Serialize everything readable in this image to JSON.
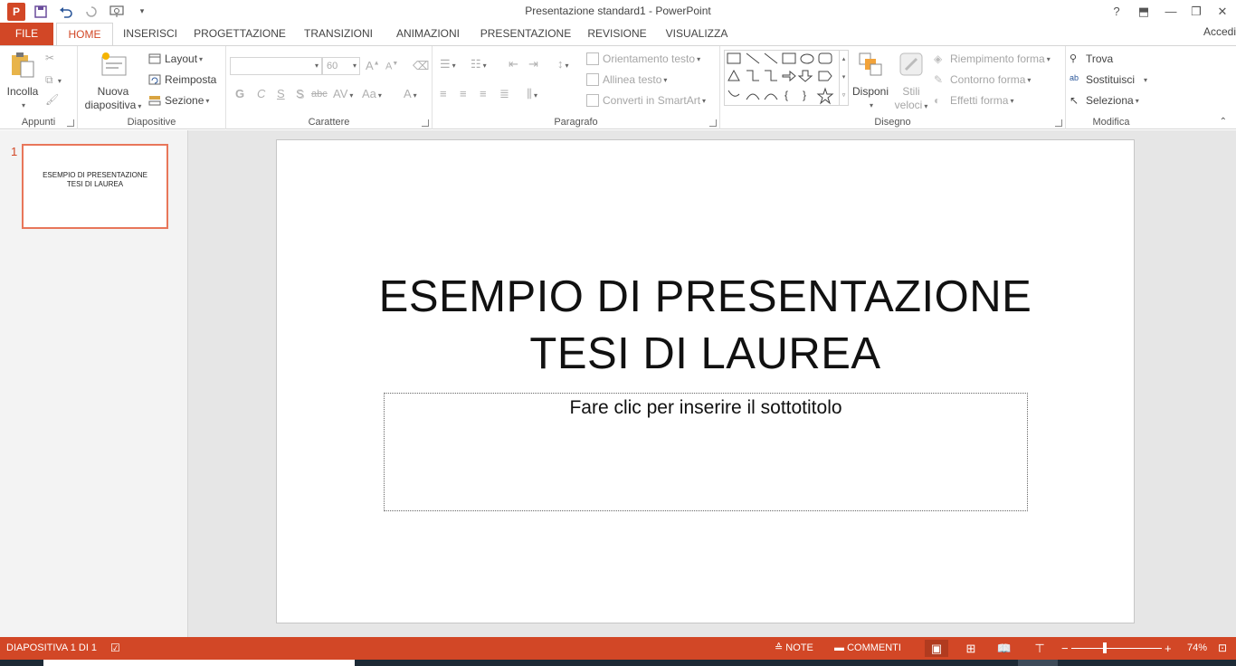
{
  "app": {
    "window_title": "Presentazione standard1 - PowerPoint",
    "logo_letter": "P",
    "signin": "Accedi"
  },
  "quick_access": {
    "icons": [
      "save-icon",
      "undo-icon",
      "redo-icon",
      "present-from-start-icon",
      "customize-icon"
    ]
  },
  "window_controls": {
    "help": "?",
    "ribbon_options": "⬒",
    "minimize": "—",
    "restore": "❐",
    "close": "✕"
  },
  "tabs": [
    {
      "label": "FILE"
    },
    {
      "label": "HOME"
    },
    {
      "label": "INSERISCI"
    },
    {
      "label": "PROGETTAZIONE"
    },
    {
      "label": "TRANSIZIONI"
    },
    {
      "label": "ANIMAZIONI"
    },
    {
      "label": "PRESENTAZIONE"
    },
    {
      "label": "REVISIONE"
    },
    {
      "label": "VISUALIZZA"
    }
  ],
  "ribbon": {
    "appunti": {
      "label": "Appunti",
      "paste": "Incolla"
    },
    "diapositive": {
      "label": "Diapositive",
      "new_slide_line1": "Nuova",
      "new_slide_line2": "diapositiva",
      "layout": "Layout",
      "reset": "Reimposta",
      "section": "Sezione"
    },
    "carattere": {
      "label": "Carattere",
      "font_size": "60",
      "buttons": [
        "G",
        "C",
        "S",
        "S",
        "abc",
        "AV",
        "Aa",
        "A"
      ]
    },
    "paragrafo": {
      "label": "Paragrafo",
      "text_direction": "Orientamento testo",
      "align_text": "Allinea testo",
      "smartart": "Converti in SmartArt"
    },
    "disegno": {
      "label": "Disegno",
      "arrange": "Disponi",
      "quick_styles_line1": "Stili",
      "quick_styles_line2": "veloci",
      "shape_fill": "Riempimento forma",
      "shape_outline": "Contorno forma",
      "shape_effects": "Effetti forma"
    },
    "modifica": {
      "label": "Modifica",
      "find": "Trova",
      "replace": "Sostituisci",
      "select": "Seleziona"
    }
  },
  "thumbnail": {
    "number": "1",
    "line1": "ESEMPIO DI PRESENTAZIONE",
    "line2": "TESI DI LAUREA"
  },
  "slide": {
    "title_line1": "ESEMPIO DI PRESENTAZIONE",
    "title_line2": "TESI DI LAUREA",
    "subtitle_placeholder": "Fare clic per inserire il sottotitolo"
  },
  "statusbar": {
    "slide_indicator": "DIAPOSITIVA 1 DI 1",
    "notes": "NOTE",
    "comments": "COMMENTI",
    "zoom_minus": "−",
    "zoom_plus": "+",
    "zoom": "74%"
  },
  "colors": {
    "accent": "#d24726",
    "thumb_border": "#e8765a"
  }
}
